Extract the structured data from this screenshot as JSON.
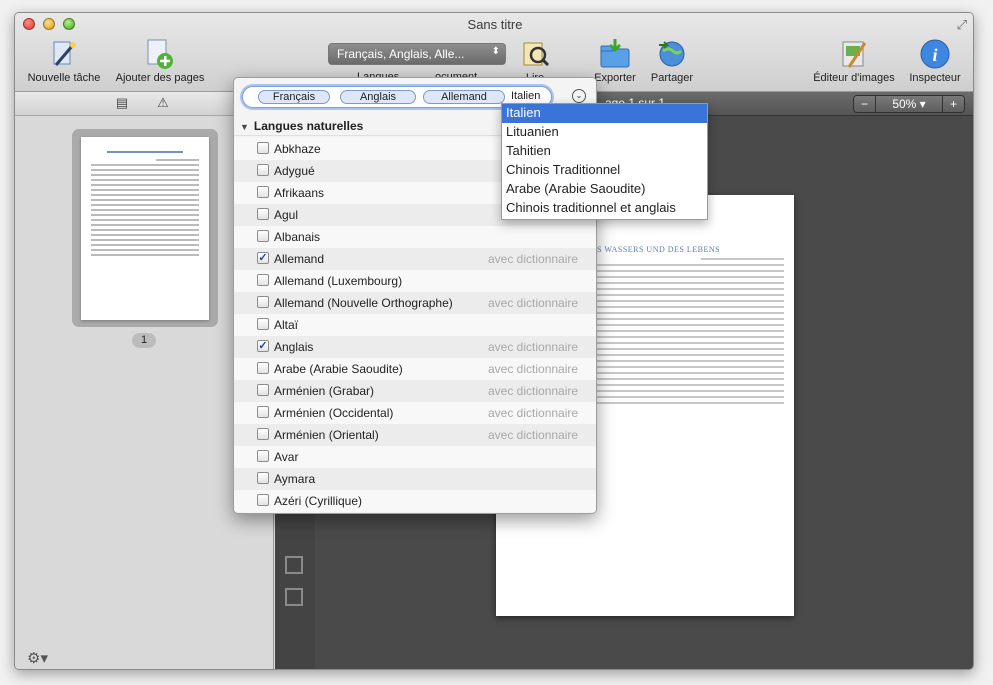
{
  "window": {
    "title": "Sans titre"
  },
  "toolbar": {
    "new_task": "Nouvelle tâche",
    "add_pages": "Ajouter des pages",
    "lang_select": "Français, Anglais, Alle...",
    "hidden_languages": "Langues",
    "hidden_document": "ocument",
    "read": "Lire",
    "export": "Exporter",
    "share": "Partager",
    "image_editor": "Éditeur d'images",
    "inspector": "Inspecteur"
  },
  "main": {
    "page_label": "age 1 sur 1",
    "zoom_value": "50% ▾",
    "doc_title": "SIS DES WASSERS UND DES LEBENS"
  },
  "sidebar": {
    "page_number": "1"
  },
  "popover": {
    "tokens": [
      "Français",
      "Anglais",
      "Allemand"
    ],
    "typing": "Italien",
    "group_header": "Langues naturelles",
    "languages": [
      {
        "name": "Abkhaze",
        "checked": false,
        "dict": ""
      },
      {
        "name": "Adygué",
        "checked": false,
        "dict": ""
      },
      {
        "name": "Afrikaans",
        "checked": false,
        "dict": ""
      },
      {
        "name": "Agul",
        "checked": false,
        "dict": ""
      },
      {
        "name": "Albanais",
        "checked": false,
        "dict": ""
      },
      {
        "name": "Allemand",
        "checked": true,
        "dict": "avec dictionnaire"
      },
      {
        "name": "Allemand (Luxembourg)",
        "checked": false,
        "dict": ""
      },
      {
        "name": "Allemand (Nouvelle Orthographe)",
        "checked": false,
        "dict": "avec dictionnaire"
      },
      {
        "name": "Altaï",
        "checked": false,
        "dict": ""
      },
      {
        "name": "Anglais",
        "checked": true,
        "dict": "avec dictionnaire"
      },
      {
        "name": "Arabe (Arabie Saoudite)",
        "checked": false,
        "dict": "avec dictionnaire"
      },
      {
        "name": "Arménien (Grabar)",
        "checked": false,
        "dict": "avec dictionnaire"
      },
      {
        "name": "Arménien (Occidental)",
        "checked": false,
        "dict": "avec dictionnaire"
      },
      {
        "name": "Arménien (Oriental)",
        "checked": false,
        "dict": "avec dictionnaire"
      },
      {
        "name": "Avar",
        "checked": false,
        "dict": ""
      },
      {
        "name": "Aymara",
        "checked": false,
        "dict": ""
      },
      {
        "name": "Azéri (Cyrillique)",
        "checked": false,
        "dict": ""
      }
    ]
  },
  "autocomplete": {
    "items": [
      "Italien",
      "Lituanien",
      "Tahitien",
      "Chinois Traditionnel",
      "Arabe (Arabie Saoudite)",
      "Chinois traditionnel et anglais"
    ],
    "selected_index": 0
  },
  "colors": {
    "selection": "#3b74d9",
    "token_bg": "#dde7f8",
    "doc_title": "#5a79b8"
  }
}
